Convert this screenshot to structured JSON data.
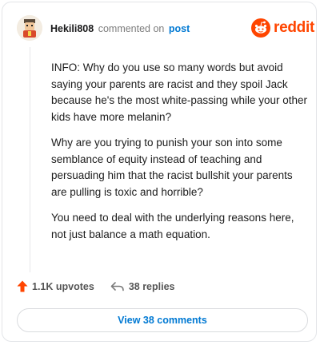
{
  "comment": {
    "username": "Hekili808",
    "commented_on": "commented on",
    "post_link": "post",
    "paragraphs": [
      "INFO: Why do you use so many words but avoid saying your parents are racist and they spoil Jack because he's the most white-passing while your other kids have more melanin?",
      "Why are you trying to punish your son into some semblance of equity instead of teaching and persuading him that the racist bullshit your parents are pulling is toxic and horrible?",
      "You need to deal with the underlying reasons here, not just balance a math equation."
    ]
  },
  "brand": {
    "wordmark": "reddit",
    "color": "#ff4500"
  },
  "actions": {
    "upvotes": "1.1K upvotes",
    "replies": "38 replies"
  },
  "view_button": {
    "label": "View 38 comments"
  },
  "icons": [
    "avatar",
    "reddit-logo-icon",
    "upvote-arrow-icon",
    "reply-icon"
  ]
}
